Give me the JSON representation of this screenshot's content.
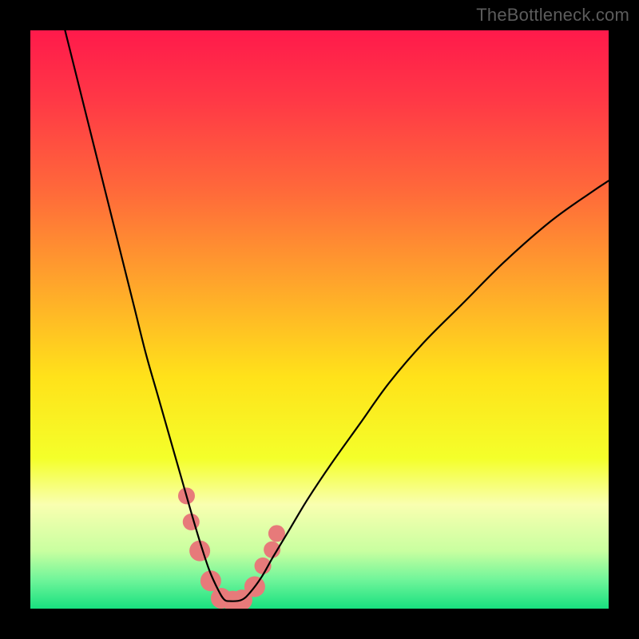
{
  "watermark": "TheBottleneck.com",
  "chart_data": {
    "type": "line",
    "title": "",
    "xlabel": "",
    "ylabel": "",
    "xlim": [
      0,
      100
    ],
    "ylim": [
      0,
      100
    ],
    "grid": false,
    "legend": false,
    "background_gradient": {
      "stops": [
        {
          "offset": 0.0,
          "color": "#ff1a4b"
        },
        {
          "offset": 0.12,
          "color": "#ff3846"
        },
        {
          "offset": 0.28,
          "color": "#ff6a3a"
        },
        {
          "offset": 0.44,
          "color": "#ffa62b"
        },
        {
          "offset": 0.6,
          "color": "#ffe21a"
        },
        {
          "offset": 0.74,
          "color": "#f4ff2a"
        },
        {
          "offset": 0.82,
          "color": "#f9ffb0"
        },
        {
          "offset": 0.9,
          "color": "#c9ffa0"
        },
        {
          "offset": 0.95,
          "color": "#70f59a"
        },
        {
          "offset": 1.0,
          "color": "#18e07f"
        }
      ]
    },
    "series": [
      {
        "name": "bottleneck-curve",
        "color": "#000000",
        "width": 2.2,
        "x": [
          6,
          8,
          10,
          12,
          14,
          16,
          18,
          20,
          22,
          24,
          26,
          28,
          29.5,
          31,
          32.5,
          33.5,
          34.5,
          36.5,
          38,
          40,
          42,
          45,
          48,
          52,
          57,
          62,
          68,
          75,
          82,
          90,
          97,
          100
        ],
        "y": [
          100,
          92,
          84,
          76,
          68,
          60,
          52,
          44,
          37,
          30,
          23,
          16,
          11,
          6.5,
          3.2,
          1.6,
          1.3,
          1.5,
          2.8,
          5.5,
          9,
          14,
          19,
          25,
          32,
          39,
          46,
          53,
          60,
          67,
          72,
          74
        ]
      }
    ],
    "markers": {
      "color": "#e77a7a",
      "radius_primary": 13,
      "radius_secondary": 10.5,
      "points": [
        {
          "x": 27.0,
          "y": 19.5,
          "r": 10.5
        },
        {
          "x": 27.8,
          "y": 15.0,
          "r": 10.5
        },
        {
          "x": 29.3,
          "y": 10.0,
          "r": 13
        },
        {
          "x": 31.2,
          "y": 4.8,
          "r": 13
        },
        {
          "x": 33.0,
          "y": 1.8,
          "r": 13
        },
        {
          "x": 35.0,
          "y": 1.3,
          "r": 13
        },
        {
          "x": 36.6,
          "y": 1.5,
          "r": 13
        },
        {
          "x": 38.8,
          "y": 3.8,
          "r": 13
        },
        {
          "x": 40.2,
          "y": 7.4,
          "r": 10.5
        },
        {
          "x": 41.8,
          "y": 10.2,
          "r": 10.5
        },
        {
          "x": 42.6,
          "y": 13.0,
          "r": 10.5
        }
      ]
    }
  }
}
